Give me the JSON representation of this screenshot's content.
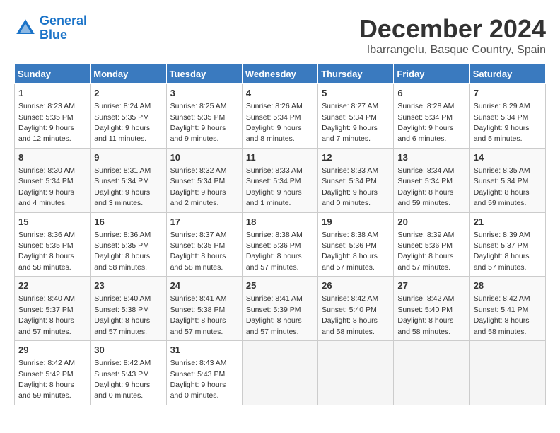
{
  "header": {
    "logo_line1": "General",
    "logo_line2": "Blue",
    "month": "December 2024",
    "location": "Ibarrangelu, Basque Country, Spain"
  },
  "weekdays": [
    "Sunday",
    "Monday",
    "Tuesday",
    "Wednesday",
    "Thursday",
    "Friday",
    "Saturday"
  ],
  "weeks": [
    [
      {
        "day": "1",
        "info": "Sunrise: 8:23 AM\nSunset: 5:35 PM\nDaylight: 9 hours\nand 12 minutes."
      },
      {
        "day": "2",
        "info": "Sunrise: 8:24 AM\nSunset: 5:35 PM\nDaylight: 9 hours\nand 11 minutes."
      },
      {
        "day": "3",
        "info": "Sunrise: 8:25 AM\nSunset: 5:35 PM\nDaylight: 9 hours\nand 9 minutes."
      },
      {
        "day": "4",
        "info": "Sunrise: 8:26 AM\nSunset: 5:34 PM\nDaylight: 9 hours\nand 8 minutes."
      },
      {
        "day": "5",
        "info": "Sunrise: 8:27 AM\nSunset: 5:34 PM\nDaylight: 9 hours\nand 7 minutes."
      },
      {
        "day": "6",
        "info": "Sunrise: 8:28 AM\nSunset: 5:34 PM\nDaylight: 9 hours\nand 6 minutes."
      },
      {
        "day": "7",
        "info": "Sunrise: 8:29 AM\nSunset: 5:34 PM\nDaylight: 9 hours\nand 5 minutes."
      }
    ],
    [
      {
        "day": "8",
        "info": "Sunrise: 8:30 AM\nSunset: 5:34 PM\nDaylight: 9 hours\nand 4 minutes."
      },
      {
        "day": "9",
        "info": "Sunrise: 8:31 AM\nSunset: 5:34 PM\nDaylight: 9 hours\nand 3 minutes."
      },
      {
        "day": "10",
        "info": "Sunrise: 8:32 AM\nSunset: 5:34 PM\nDaylight: 9 hours\nand 2 minutes."
      },
      {
        "day": "11",
        "info": "Sunrise: 8:33 AM\nSunset: 5:34 PM\nDaylight: 9 hours\nand 1 minute."
      },
      {
        "day": "12",
        "info": "Sunrise: 8:33 AM\nSunset: 5:34 PM\nDaylight: 9 hours\nand 0 minutes."
      },
      {
        "day": "13",
        "info": "Sunrise: 8:34 AM\nSunset: 5:34 PM\nDaylight: 8 hours\nand 59 minutes."
      },
      {
        "day": "14",
        "info": "Sunrise: 8:35 AM\nSunset: 5:34 PM\nDaylight: 8 hours\nand 59 minutes."
      }
    ],
    [
      {
        "day": "15",
        "info": "Sunrise: 8:36 AM\nSunset: 5:35 PM\nDaylight: 8 hours\nand 58 minutes."
      },
      {
        "day": "16",
        "info": "Sunrise: 8:36 AM\nSunset: 5:35 PM\nDaylight: 8 hours\nand 58 minutes."
      },
      {
        "day": "17",
        "info": "Sunrise: 8:37 AM\nSunset: 5:35 PM\nDaylight: 8 hours\nand 58 minutes."
      },
      {
        "day": "18",
        "info": "Sunrise: 8:38 AM\nSunset: 5:36 PM\nDaylight: 8 hours\nand 57 minutes."
      },
      {
        "day": "19",
        "info": "Sunrise: 8:38 AM\nSunset: 5:36 PM\nDaylight: 8 hours\nand 57 minutes."
      },
      {
        "day": "20",
        "info": "Sunrise: 8:39 AM\nSunset: 5:36 PM\nDaylight: 8 hours\nand 57 minutes."
      },
      {
        "day": "21",
        "info": "Sunrise: 8:39 AM\nSunset: 5:37 PM\nDaylight: 8 hours\nand 57 minutes."
      }
    ],
    [
      {
        "day": "22",
        "info": "Sunrise: 8:40 AM\nSunset: 5:37 PM\nDaylight: 8 hours\nand 57 minutes."
      },
      {
        "day": "23",
        "info": "Sunrise: 8:40 AM\nSunset: 5:38 PM\nDaylight: 8 hours\nand 57 minutes."
      },
      {
        "day": "24",
        "info": "Sunrise: 8:41 AM\nSunset: 5:38 PM\nDaylight: 8 hours\nand 57 minutes."
      },
      {
        "day": "25",
        "info": "Sunrise: 8:41 AM\nSunset: 5:39 PM\nDaylight: 8 hours\nand 57 minutes."
      },
      {
        "day": "26",
        "info": "Sunrise: 8:42 AM\nSunset: 5:40 PM\nDaylight: 8 hours\nand 58 minutes."
      },
      {
        "day": "27",
        "info": "Sunrise: 8:42 AM\nSunset: 5:40 PM\nDaylight: 8 hours\nand 58 minutes."
      },
      {
        "day": "28",
        "info": "Sunrise: 8:42 AM\nSunset: 5:41 PM\nDaylight: 8 hours\nand 58 minutes."
      }
    ],
    [
      {
        "day": "29",
        "info": "Sunrise: 8:42 AM\nSunset: 5:42 PM\nDaylight: 8 hours\nand 59 minutes."
      },
      {
        "day": "30",
        "info": "Sunrise: 8:42 AM\nSunset: 5:43 PM\nDaylight: 9 hours\nand 0 minutes."
      },
      {
        "day": "31",
        "info": "Sunrise: 8:43 AM\nSunset: 5:43 PM\nDaylight: 9 hours\nand 0 minutes."
      },
      null,
      null,
      null,
      null
    ]
  ]
}
